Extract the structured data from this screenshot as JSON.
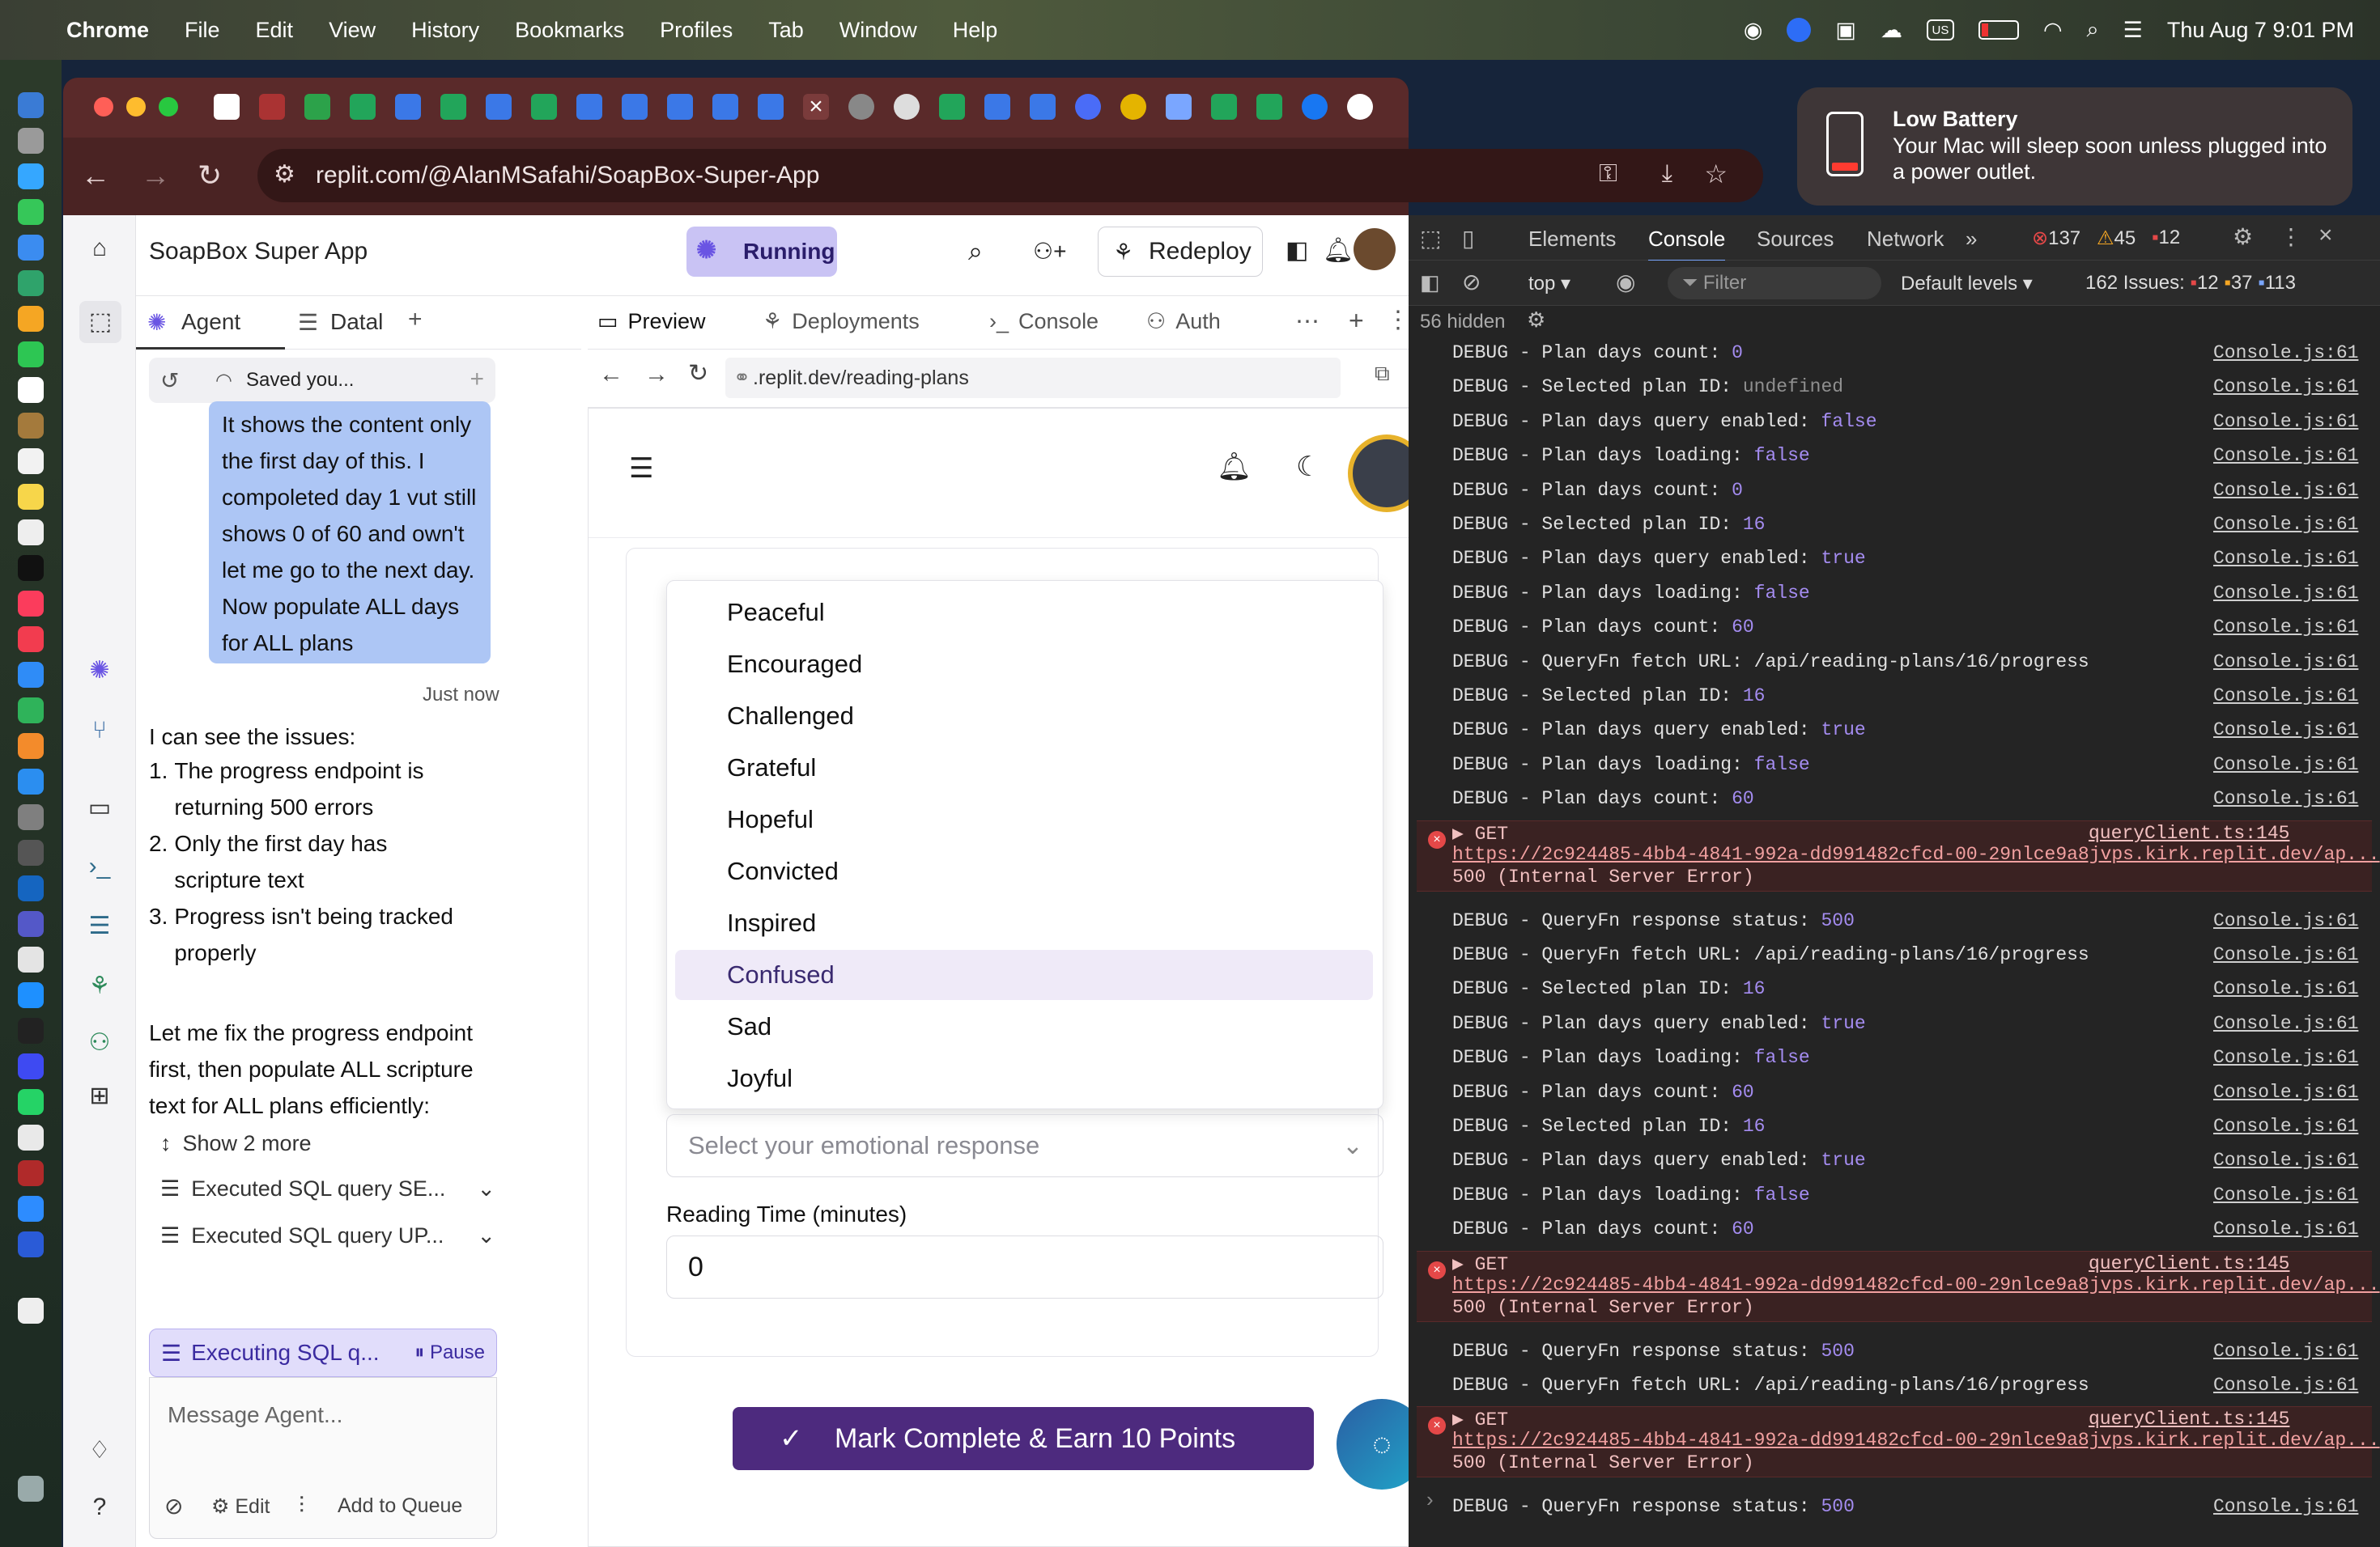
{
  "menubar": {
    "app": "Chrome",
    "items": [
      "File",
      "Edit",
      "View",
      "History",
      "Bookmarks",
      "Profiles",
      "Tab",
      "Window",
      "Help"
    ],
    "input_indicator": "US",
    "datetime": "Thu Aug 7  9:01 PM"
  },
  "notification": {
    "title": "Low Battery",
    "body": "Your Mac will sleep soon unless plugged into a power outlet."
  },
  "browser": {
    "url": "replit.com/@AlanMSafahi/SoapBox-Super-App"
  },
  "replit": {
    "app_name": "SoapBox Super App",
    "status": "Running",
    "redeploy": "Redeploy",
    "left_tabs": [
      "Agent",
      "Datal"
    ],
    "mid_tabs": [
      "Preview",
      "Deployments",
      "Console",
      "Auth"
    ],
    "saved_label": "Saved you...",
    "preview_url": ".replit.dev/reading-plans"
  },
  "chat": {
    "user_message": "It shows the content only the first day of this. I compoleted day 1 vut still shows 0 of 60 and own't let me go to the next day. Now populate ALL days for ALL plans",
    "time": "Just now",
    "intro": "I can see the issues:",
    "issues": [
      "The progress endpoint is returning 500 errors",
      "Only the first day has scripture text",
      "Progress isn't being tracked properly"
    ],
    "followup": "Let me fix the progress endpoint first, then populate ALL scripture text for ALL plans efficiently:",
    "show_more": "Show 2 more",
    "steps": [
      "Executed SQL query SE...",
      "Executed SQL query UP..."
    ],
    "executing": "Executing SQL q...",
    "pause": "Pause",
    "placeholder": "Message Agent...",
    "edit": "Edit",
    "queue": "Add to Queue"
  },
  "form": {
    "options": [
      "Peaceful",
      "Encouraged",
      "Challenged",
      "Grateful",
      "Hopeful",
      "Convicted",
      "Inspired",
      "Confused",
      "Sad",
      "Joyful"
    ],
    "selected": "Confused",
    "select_placeholder": "Select your emotional response",
    "reading_time_label": "Reading Time (minutes)",
    "reading_time_value": "0",
    "submit": "Mark Complete & Earn 10 Points"
  },
  "devtools": {
    "tabs": [
      "Elements",
      "Console",
      "Sources",
      "Network"
    ],
    "errors": "137",
    "warnings": "45",
    "issues_badge": "12",
    "context": "top",
    "filter": "Filter",
    "levels": "Default levels",
    "issues_summary": "162 Issues:",
    "issue_red": "12",
    "issue_yellow": "37",
    "issue_blue": "113",
    "hidden": "56 hidden",
    "logs": [
      {
        "k": "DEBUG - Plan days count:",
        "v": "0",
        "s": "Console.js:61"
      },
      {
        "k": "DEBUG - Selected plan ID:",
        "v": "undefined",
        "s": "Console.js:61",
        "u": true
      },
      {
        "k": "DEBUG - Plan days query enabled:",
        "v": "false",
        "s": "Console.js:61"
      },
      {
        "k": "DEBUG - Plan days loading:",
        "v": "false",
        "s": "Console.js:61"
      },
      {
        "k": "DEBUG - Plan days count:",
        "v": "0",
        "s": "Console.js:61"
      },
      {
        "k": "DEBUG - Selected plan ID:",
        "v": "16",
        "s": "Console.js:61"
      },
      {
        "k": "DEBUG - Plan days query enabled:",
        "v": "true",
        "s": "Console.js:61"
      },
      {
        "k": "DEBUG - Plan days loading:",
        "v": "false",
        "s": "Console.js:61"
      },
      {
        "k": "DEBUG - Plan days count:",
        "v": "60",
        "s": "Console.js:61"
      },
      {
        "k": "DEBUG - QueryFn fetch URL: /api/reading-plans/16/progress",
        "v": "",
        "s": "Console.js:61"
      },
      {
        "k": "DEBUG - Selected plan ID:",
        "v": "16",
        "s": "Console.js:61"
      },
      {
        "k": "DEBUG - Plan days query enabled:",
        "v": "true",
        "s": "Console.js:61"
      },
      {
        "k": "DEBUG - Plan days loading:",
        "v": "false",
        "s": "Console.js:61"
      },
      {
        "k": "DEBUG - Plan days count:",
        "v": "60",
        "s": "Console.js:61"
      }
    ],
    "error": {
      "method": "▶ GET",
      "url": "https://2c924485-4bb4-4841-992a-dd991482cfcd-00-29nlce9a8jvps.kirk.replit.dev/ap...",
      "status": "500 (Internal Server Error)",
      "src": "queryClient.ts:145"
    },
    "logs2": [
      {
        "k": "DEBUG - QueryFn response status:",
        "v": "500",
        "s": "Console.js:61"
      },
      {
        "k": "DEBUG - QueryFn fetch URL: /api/reading-plans/16/progress",
        "v": "",
        "s": "Console.js:61"
      },
      {
        "k": "DEBUG - Selected plan ID:",
        "v": "16",
        "s": "Console.js:61"
      },
      {
        "k": "DEBUG - Plan days query enabled:",
        "v": "true",
        "s": "Console.js:61"
      },
      {
        "k": "DEBUG - Plan days loading:",
        "v": "false",
        "s": "Console.js:61"
      },
      {
        "k": "DEBUG - Plan days count:",
        "v": "60",
        "s": "Console.js:61"
      },
      {
        "k": "DEBUG - Selected plan ID:",
        "v": "16",
        "s": "Console.js:61"
      },
      {
        "k": "DEBUG - Plan days query enabled:",
        "v": "true",
        "s": "Console.js:61"
      },
      {
        "k": "DEBUG - Plan days loading:",
        "v": "false",
        "s": "Console.js:61"
      },
      {
        "k": "DEBUG - Plan days count:",
        "v": "60",
        "s": "Console.js:61"
      }
    ],
    "logs3": [
      {
        "k": "DEBUG - QueryFn response status:",
        "v": "500",
        "s": "Console.js:61"
      },
      {
        "k": "DEBUG - QueryFn fetch URL: /api/reading-plans/16/progress",
        "v": "",
        "s": "Console.js:61"
      }
    ],
    "logs4": [
      {
        "k": "DEBUG - QueryFn response status:",
        "v": "500",
        "s": "Console.js:61"
      }
    ]
  }
}
